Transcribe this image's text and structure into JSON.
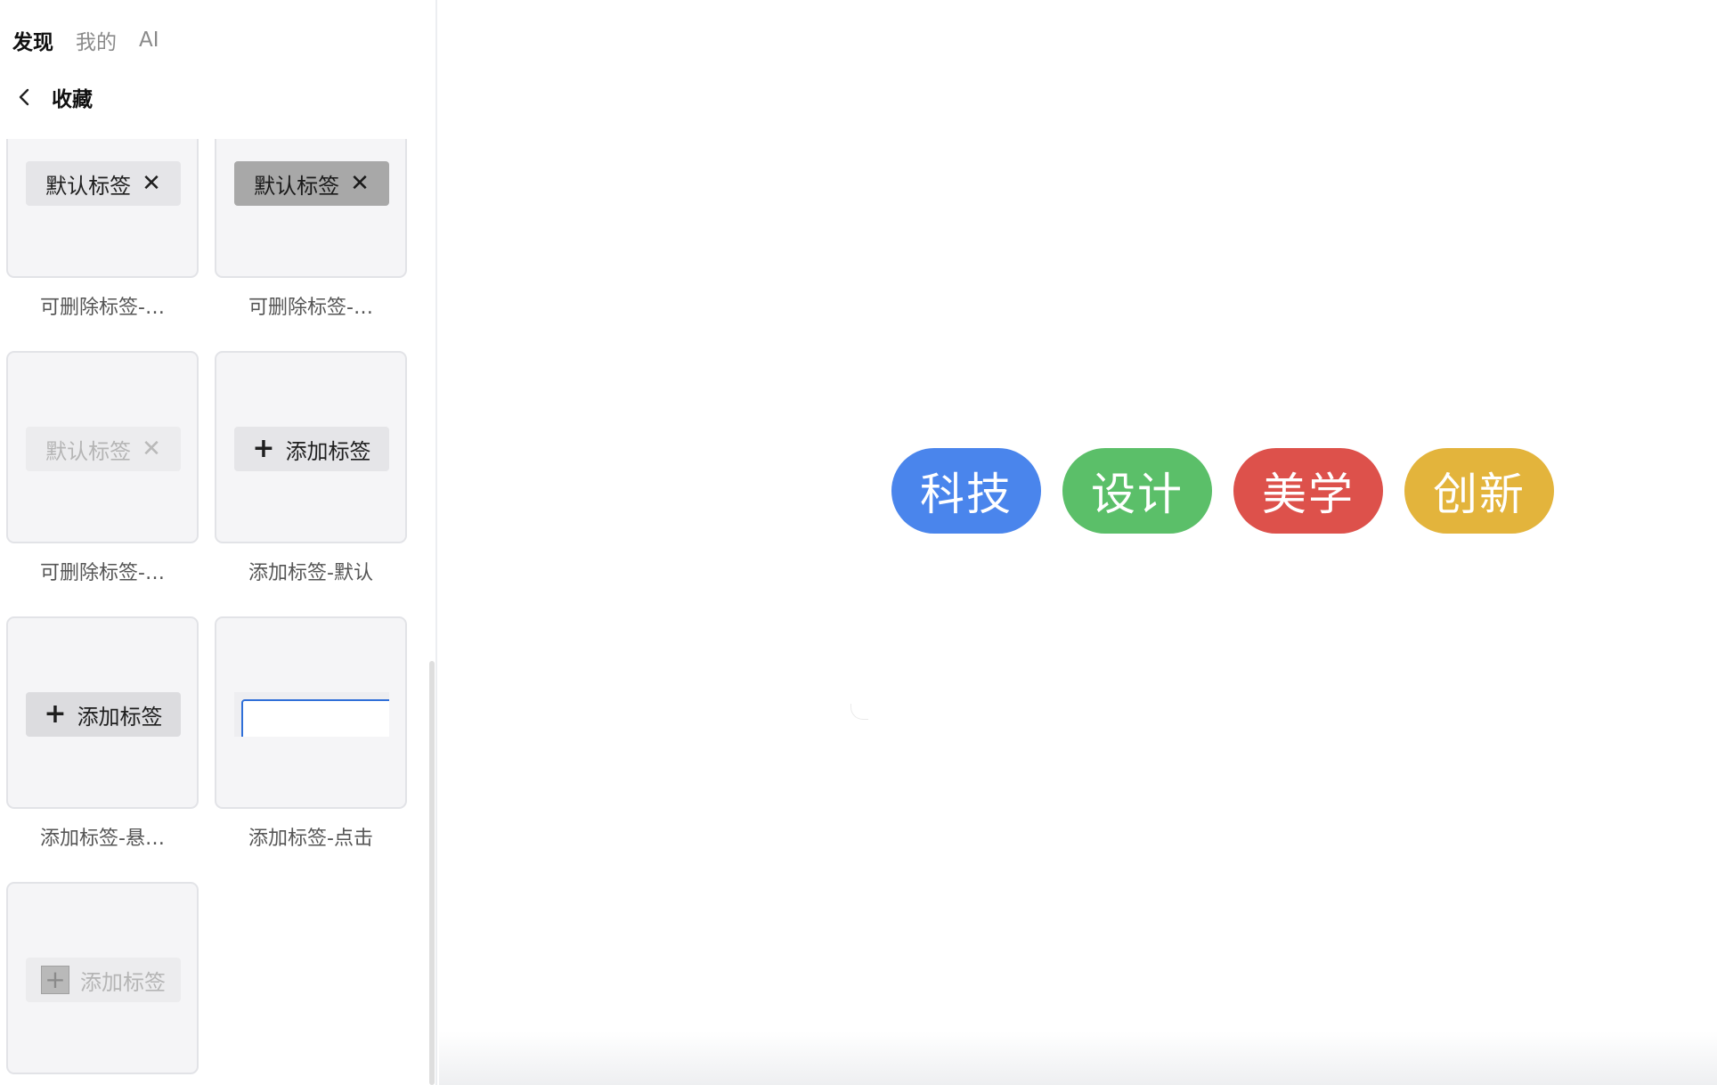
{
  "tabs": [
    {
      "label": "发现",
      "active": true
    },
    {
      "label": "我的",
      "active": false
    },
    {
      "label": "AI",
      "active": false
    }
  ],
  "header": {
    "title": "收藏",
    "back_icon": "chevron-left-icon"
  },
  "cards": [
    {
      "tag_label": "默认标签",
      "tag_icon": "close-icon",
      "icon_glyph": "✕",
      "caption": "可删除标签-…"
    },
    {
      "tag_label": "默认标签",
      "tag_icon": "close-icon",
      "icon_glyph": "✕",
      "caption": "可删除标签-…"
    },
    {
      "tag_label": "默认标签",
      "tag_icon": "close-icon",
      "icon_glyph": "✕",
      "caption": "可删除标签-…"
    },
    {
      "tag_label": "添加标签",
      "tag_icon": "plus-icon",
      "icon_glyph": "+",
      "caption": "添加标签-默认"
    },
    {
      "tag_label": "添加标签",
      "tag_icon": "plus-icon",
      "icon_glyph": "+",
      "caption": "添加标签-悬…"
    },
    {
      "tag_label": "",
      "tag_icon": "",
      "icon_glyph": "",
      "caption": "添加标签-点击"
    },
    {
      "tag_label": "添加标签",
      "tag_icon": "plus-icon",
      "icon_glyph": "+",
      "caption": ""
    }
  ],
  "canvas": {
    "pills": [
      {
        "label": "科技",
        "color": "#4a85ec"
      },
      {
        "label": "设计",
        "color": "#5bbf69"
      },
      {
        "label": "美学",
        "color": "#dd514b"
      },
      {
        "label": "创新",
        "color": "#e3b43c"
      }
    ]
  },
  "colors": {
    "input_focus_border": "#2f6fd8",
    "card_background": "#f5f5f7"
  }
}
